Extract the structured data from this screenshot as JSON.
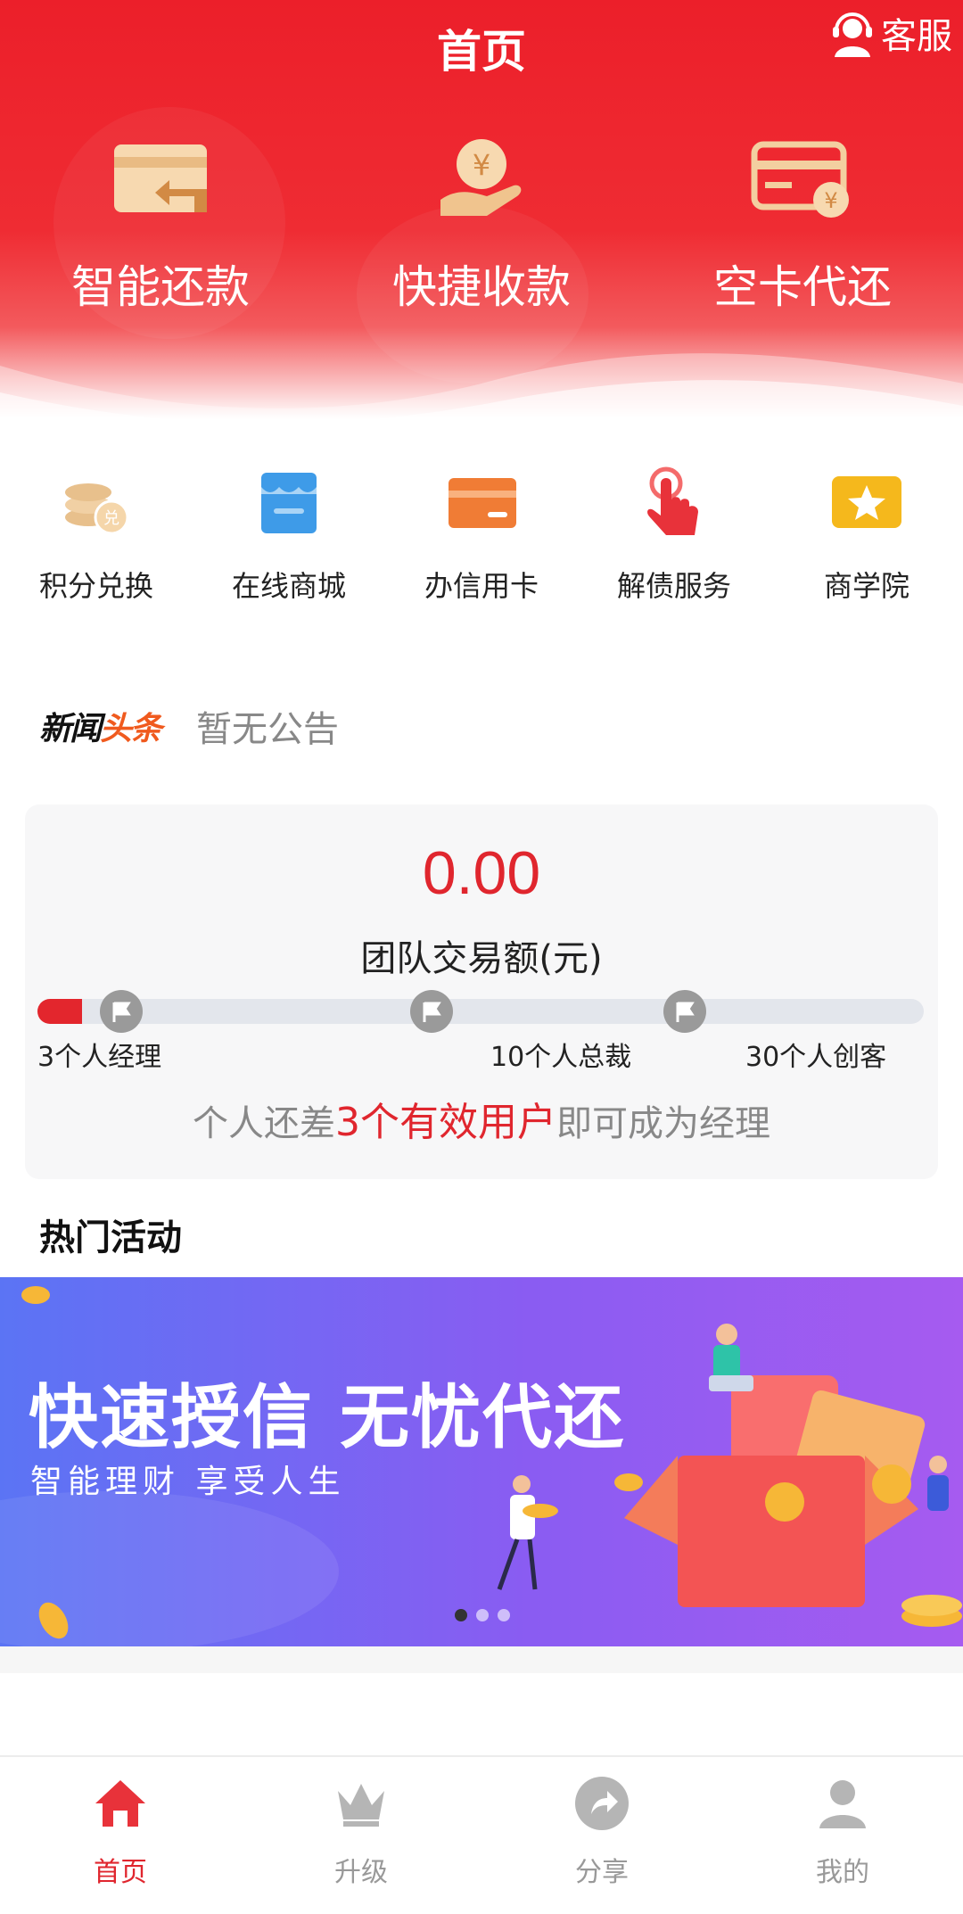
{
  "header": {
    "title": "首页",
    "service_label": "客服"
  },
  "colors": {
    "brand_red": "#e0262e",
    "banner_start": "#5b74f4",
    "banner_end": "#a65bf0"
  },
  "top_tools": [
    {
      "label": "智能还款",
      "icon": "card-return-icon"
    },
    {
      "label": "快捷收款",
      "icon": "hand-yuan-coin-icon"
    },
    {
      "label": "空卡代还",
      "icon": "card-yuan-icon"
    }
  ],
  "grid": [
    {
      "label": "积分兑换",
      "icon": "coins-exchange-icon"
    },
    {
      "label": "在线商城",
      "icon": "store-icon"
    },
    {
      "label": "办信用卡",
      "icon": "credit-card-icon"
    },
    {
      "label": "解债服务",
      "icon": "tap-finger-icon"
    },
    {
      "label": "商学院",
      "icon": "star-icon"
    }
  ],
  "news": {
    "logo_black": "新闻",
    "logo_orange": "头条",
    "text": "暂无公告"
  },
  "team": {
    "amount": "0.00",
    "amount_label": "团队交易额(元)",
    "progress": 0.05,
    "milestones": [
      "3个人经理",
      "10个人总裁",
      "30个人创客"
    ],
    "hint_prefix": "个人还差",
    "hint_highlight": "3个有效用户",
    "hint_suffix": "即可成为经理"
  },
  "hot": {
    "title": "热门活动"
  },
  "banner": {
    "headline": "快速授信 无忧代还",
    "subline": "智能理财 享受人生"
  },
  "tabs": [
    {
      "label": "首页",
      "icon": "home-icon"
    },
    {
      "label": "升级",
      "icon": "crown-icon"
    },
    {
      "label": "分享",
      "icon": "share-icon"
    },
    {
      "label": "我的",
      "icon": "user-icon"
    }
  ]
}
